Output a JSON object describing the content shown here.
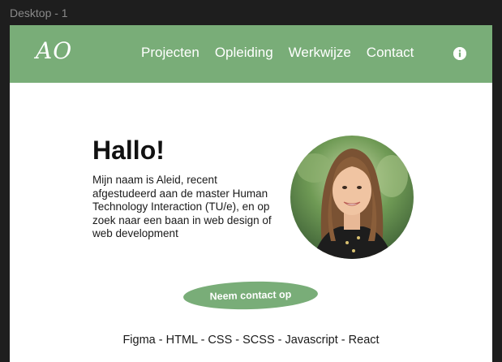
{
  "canvas": {
    "frame_label": "Desktop - 1"
  },
  "header": {
    "logo": "AO",
    "nav": [
      "Projecten",
      "Opleiding",
      "Werkwijze",
      "Contact"
    ],
    "info_icon": "info-icon"
  },
  "hero": {
    "title": "Hallo!",
    "text": "Mijn naam is Aleid, recent afgestudeerd aan de master Human Technology Interaction (TU/e), en op zoek naar een baan in web design of web development",
    "cta": "Neem contact op"
  },
  "skills": "Figma - HTML - CSS - SCSS - Javascript - React",
  "colors": {
    "accent": "#79ad78",
    "canvas_bg": "#1e1e1e",
    "page_bg": "#ffffff"
  }
}
